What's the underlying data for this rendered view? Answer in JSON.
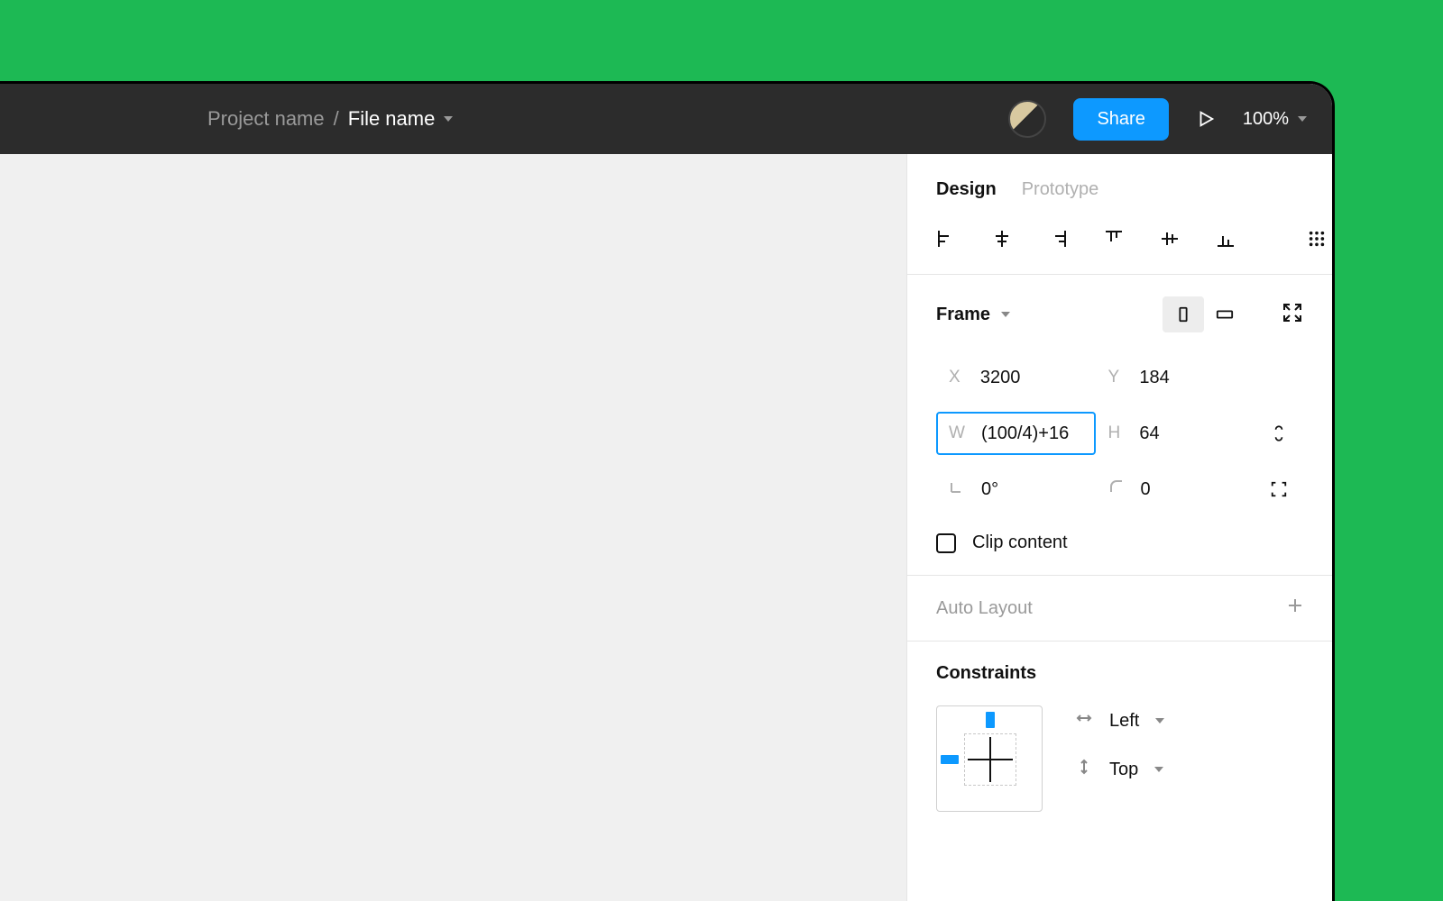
{
  "toolbar": {
    "project_name": "Project name",
    "file_name": "File name",
    "share_label": "Share",
    "zoom_label": "100%"
  },
  "panel": {
    "tabs": {
      "design": "Design",
      "prototype": "Prototype"
    },
    "frame": {
      "label": "Frame",
      "x_label": "X",
      "x_value": "3200",
      "y_label": "Y",
      "y_value": "184",
      "w_label": "W",
      "w_value": "(100/4)+16",
      "h_label": "H",
      "h_value": "64",
      "rot_value": "0°",
      "rad_value": "0",
      "clip_label": "Clip content"
    },
    "autolayout_label": "Auto Layout",
    "constraints": {
      "label": "Constraints",
      "horizontal": "Left",
      "vertical": "Top"
    }
  }
}
